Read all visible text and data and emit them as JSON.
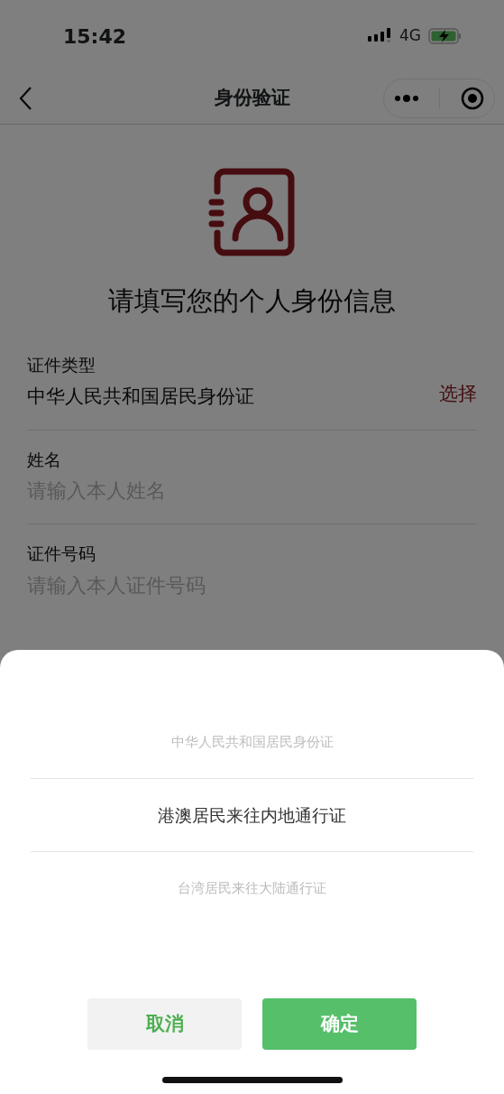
{
  "status_bar": {
    "time": "15:42",
    "network": "4G"
  },
  "nav_bar": {
    "title": "身份验证"
  },
  "heading": "请填写您的个人身份信息",
  "fields": [
    {
      "kind": "select",
      "label": "证件类型",
      "value": "中华人民共和国居民身份证",
      "action": "选择"
    },
    {
      "kind": "input",
      "label": "姓名",
      "placeholder": "请输入本人姓名"
    },
    {
      "kind": "input",
      "label": "证件号码",
      "placeholder": "请输入本人证件号码"
    }
  ],
  "picker": {
    "options": [
      {
        "label": "中华人民共和国居民身份证",
        "selected": false
      },
      {
        "label": "港澳居民来往内地通行证",
        "selected": true
      },
      {
        "label": "台湾居民来往大陆通行证",
        "selected": false
      }
    ],
    "buttons": [
      {
        "kind": "cancel",
        "label": "取消"
      },
      {
        "kind": "confirm",
        "label": "确定"
      }
    ]
  }
}
